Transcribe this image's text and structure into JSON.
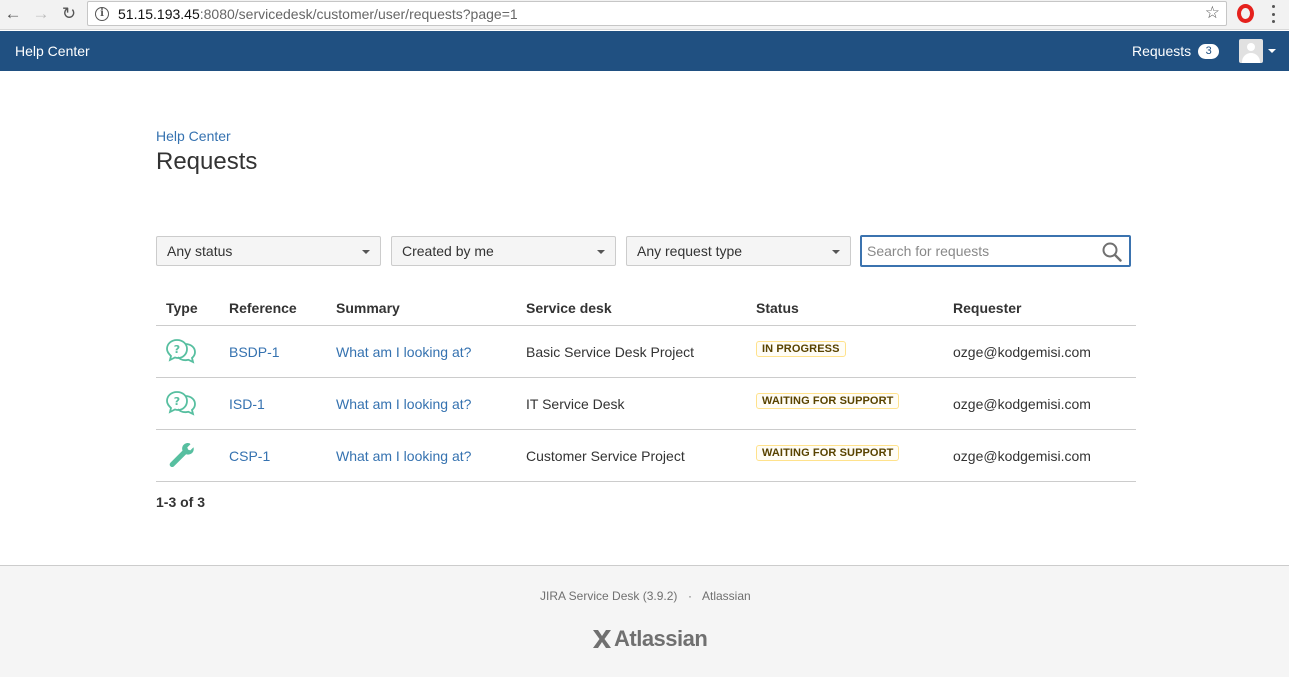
{
  "browser": {
    "url_host": "51.15.193.45",
    "url_rest": ":8080/servicedesk/customer/user/requests?page=1"
  },
  "header": {
    "title": "Help Center",
    "requests_label": "Requests",
    "requests_count": "3"
  },
  "breadcrumb": "Help Center",
  "page_title": "Requests",
  "filters": {
    "status": "Any status",
    "creator": "Created by me",
    "request_type": "Any request type",
    "search_placeholder": "Search for requests",
    "search_value": ""
  },
  "table": {
    "columns": [
      "Type",
      "Reference",
      "Summary",
      "Service desk",
      "Status",
      "Requester"
    ],
    "rows": [
      {
        "type_icon": "question-bubble-icon",
        "reference": "BSDP-1",
        "summary": "What am I looking at?",
        "service_desk": "Basic Service Desk Project",
        "status": "IN PROGRESS",
        "requester": "ozge@kodgemisi.com"
      },
      {
        "type_icon": "question-bubble-icon",
        "reference": "ISD-1",
        "summary": "What am I looking at?",
        "service_desk": "IT Service Desk",
        "status": "WAITING FOR SUPPORT",
        "requester": "ozge@kodgemisi.com"
      },
      {
        "type_icon": "wrench-icon",
        "reference": "CSP-1",
        "summary": "What am I looking at?",
        "service_desk": "Customer Service Project",
        "status": "WAITING FOR SUPPORT",
        "requester": "ozge@kodgemisi.com"
      }
    ]
  },
  "pagination": "1-3 of 3",
  "footer": {
    "product": "JIRA Service Desk (3.9.2)",
    "separator": "·",
    "company_link": "Atlassian",
    "logo_text": "Atlassian"
  },
  "colors": {
    "header_bg": "#205081",
    "link": "#3572b0",
    "icon_teal": "#57bfa0",
    "lozenge_border": "#ffe28c",
    "lozenge_text": "#594300"
  }
}
